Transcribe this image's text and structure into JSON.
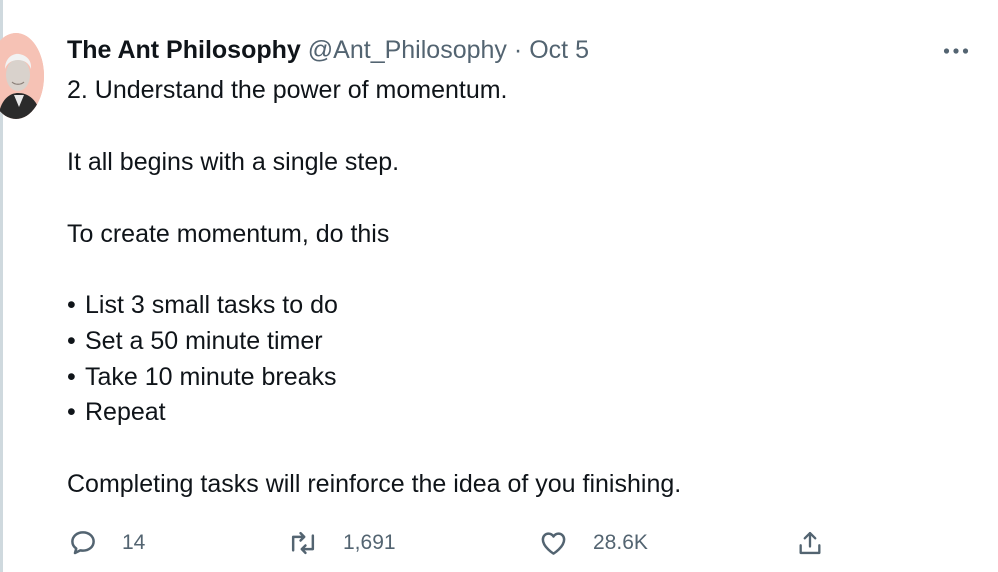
{
  "tweet": {
    "author": {
      "name": "The Ant Philosophy",
      "handle": "@Ant_Philosophy",
      "avatar_icon": "author-avatar",
      "avatar_bg": "#f6c2b5"
    },
    "separator": "·",
    "date": "Oct 5",
    "more_icon": "more-options-icon",
    "text": {
      "line1": "2. Understand the power of momentum.",
      "line2": "It all begins with a single step.",
      "line3": "To create momentum, do this",
      "bullet_symbol": "•",
      "bullets": [
        "List 3 small tasks to do",
        "Set a 50 minute timer",
        "Take 10 minute breaks",
        "Repeat"
      ],
      "closing": "Completing tasks will reinforce the idea of you finishing."
    },
    "actions": {
      "reply": {
        "icon": "reply-icon",
        "count": "14"
      },
      "retweet": {
        "icon": "retweet-icon",
        "count": "1,691"
      },
      "like": {
        "icon": "heart-icon",
        "count": "28.6K"
      },
      "share": {
        "icon": "share-icon"
      }
    }
  },
  "colors": {
    "text_primary": "#0f1419",
    "text_secondary": "#536471",
    "thread_line": "#cfd9de"
  }
}
